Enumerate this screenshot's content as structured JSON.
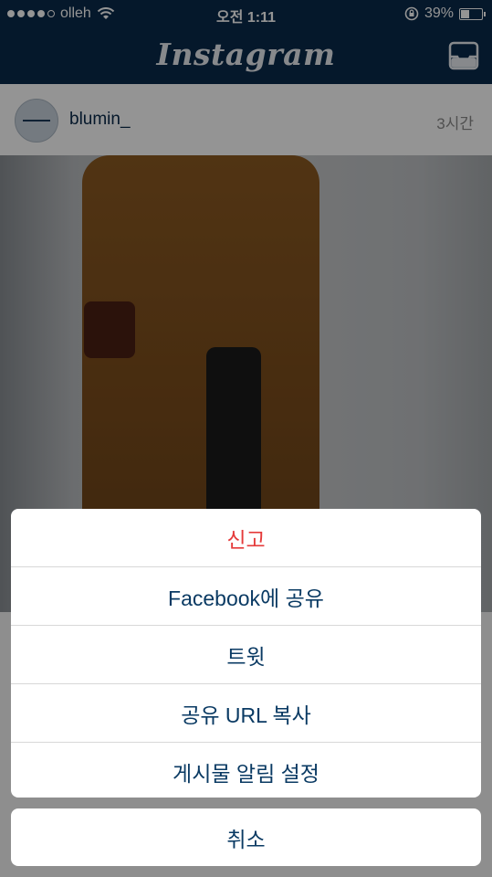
{
  "status_bar": {
    "carrier": "olleh",
    "time": "오전 1:11",
    "battery_percent_label": "39%",
    "battery_level": 0.39
  },
  "nav": {
    "logo": "Instagram",
    "inbox_icon": "inbox-icon"
  },
  "post": {
    "username": "blumin_",
    "time_ago": "3시간"
  },
  "action_sheet": {
    "items": [
      {
        "label": "신고",
        "style": "danger"
      },
      {
        "label": "Facebook에 공유",
        "style": "default"
      },
      {
        "label": "트윗",
        "style": "default"
      },
      {
        "label": "공유 URL 복사",
        "style": "default"
      },
      {
        "label": "게시물 알림 설정",
        "style": "default"
      }
    ],
    "cancel_label": "취소"
  },
  "colors": {
    "nav_bg": "#0a2a4a",
    "danger": "#e53b3b",
    "action_text": "#0a3a63"
  }
}
